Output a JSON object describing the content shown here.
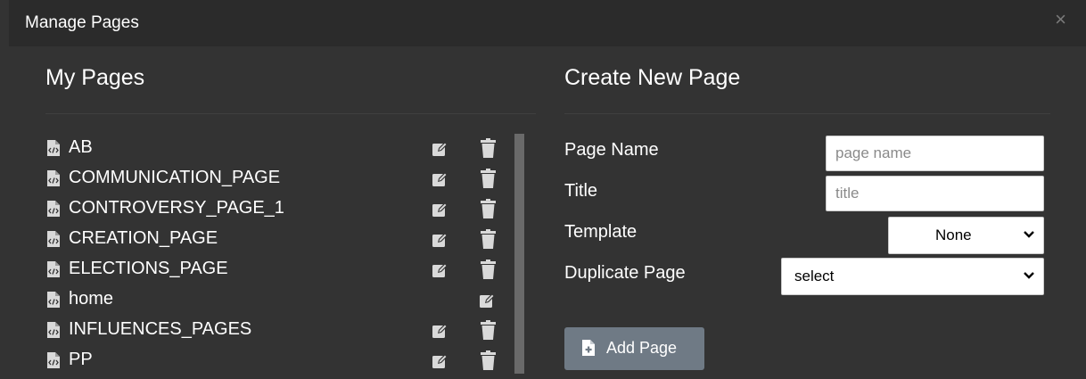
{
  "modal": {
    "title": "Manage Pages",
    "close_glyph": "×"
  },
  "my_pages": {
    "heading": "My Pages",
    "items": [
      {
        "name": "AB",
        "icon": "file-code-icon",
        "edit": true,
        "delete": true
      },
      {
        "name": "COMMUNICATION_PAGE",
        "icon": "file-code-icon",
        "edit": true,
        "delete": true
      },
      {
        "name": "CONTROVERSY_PAGE_1",
        "icon": "file-code-icon",
        "edit": true,
        "delete": true
      },
      {
        "name": "CREATION_PAGE",
        "icon": "file-code-icon",
        "edit": true,
        "delete": true
      },
      {
        "name": "ELECTIONS_PAGE",
        "icon": "file-code-icon",
        "edit": true,
        "delete": true
      },
      {
        "name": "home",
        "icon": "file-code-icon",
        "edit": true,
        "delete": false
      },
      {
        "name": "INFLUENCES_PAGES",
        "icon": "file-code-icon",
        "edit": true,
        "delete": true
      },
      {
        "name": "PP",
        "icon": "file-code-icon",
        "edit": true,
        "delete": true
      }
    ]
  },
  "create_page": {
    "heading": "Create New Page",
    "page_name": {
      "label": "Page Name",
      "placeholder": "page name",
      "value": ""
    },
    "title": {
      "label": "Title",
      "placeholder": "title",
      "value": ""
    },
    "template": {
      "label": "Template",
      "selected": "None"
    },
    "duplicate": {
      "label": "Duplicate Page",
      "selected": "select"
    },
    "add_button": {
      "label": "Add Page",
      "icon": "file-plus-icon"
    }
  },
  "colors": {
    "modal_bg": "#333333",
    "header_bg": "#2b2b2b",
    "button_bg": "#6f7a85",
    "icon_color": "#d9d9d9"
  }
}
